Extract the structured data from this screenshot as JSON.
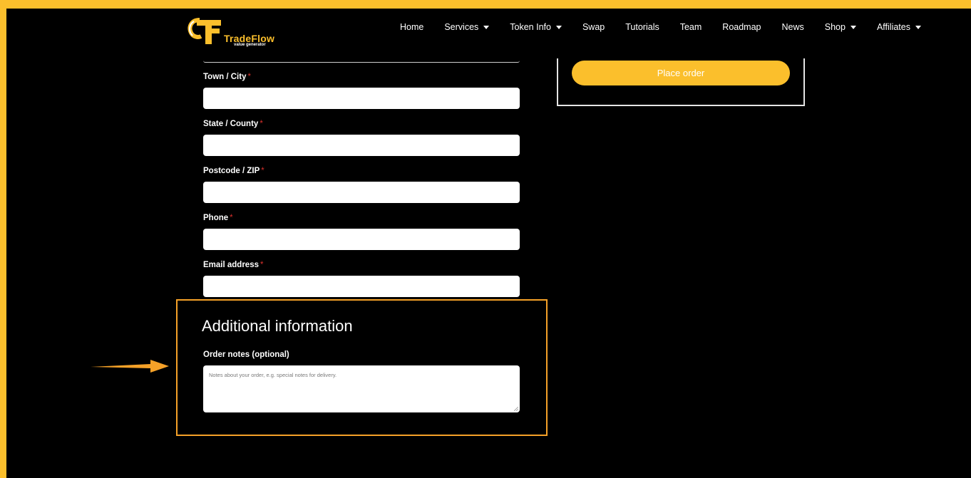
{
  "brand": {
    "name": "TradeFlow",
    "tagline": "value generator"
  },
  "nav": [
    {
      "label": "Home",
      "dropdown": false
    },
    {
      "label": "Services",
      "dropdown": true
    },
    {
      "label": "Token Info",
      "dropdown": true
    },
    {
      "label": "Swap",
      "dropdown": false
    },
    {
      "label": "Tutorials",
      "dropdown": false
    },
    {
      "label": "Team",
      "dropdown": false
    },
    {
      "label": "Roadmap",
      "dropdown": false
    },
    {
      "label": "News",
      "dropdown": false
    },
    {
      "label": "Shop",
      "dropdown": true
    },
    {
      "label": "Affiliates",
      "dropdown": true
    }
  ],
  "form": {
    "required_marker": "*",
    "town": {
      "label": "Town / City",
      "value": ""
    },
    "state": {
      "label": "State / County",
      "value": ""
    },
    "postcode": {
      "label": "Postcode / ZIP",
      "value": ""
    },
    "phone": {
      "label": "Phone",
      "value": ""
    },
    "email": {
      "label": "Email address",
      "value": ""
    }
  },
  "additional": {
    "title": "Additional information",
    "notes_label": "Order notes (optional)",
    "notes_placeholder": "Notes about your order, e.g. special notes for delivery."
  },
  "order": {
    "place_order_label": "Place order"
  },
  "colors": {
    "accent": "#fbbf2c",
    "highlight": "#f5a128",
    "required": "#d9302c",
    "background": "#000000"
  },
  "icons": {
    "logo": "tradeflow-logo-icon",
    "caret": "chevron-down-icon",
    "pointer": "arrow-right-icon"
  }
}
